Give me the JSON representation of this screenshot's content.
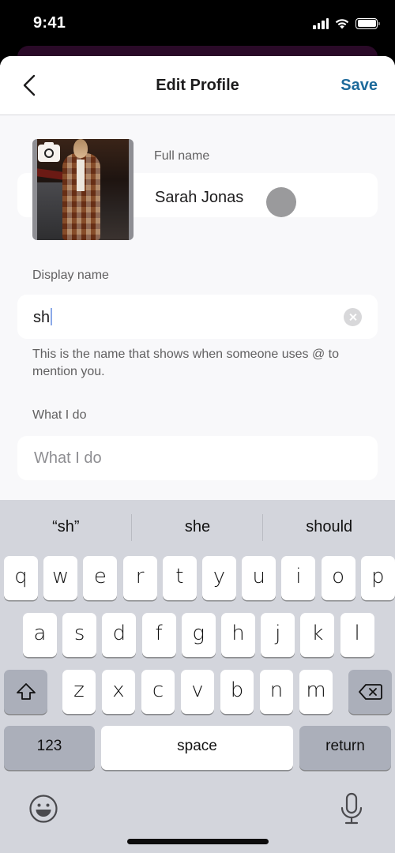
{
  "status_bar": {
    "time": "9:41",
    "signal_icon": "cellular-signal-icon",
    "wifi_icon": "wifi-icon",
    "battery_icon": "battery-icon",
    "battery_level_percent": 100
  },
  "nav": {
    "back_icon": "chevron-left-icon",
    "title": "Edit Profile",
    "save_label": "Save",
    "accent_color": "#1d6a9b"
  },
  "profile": {
    "photo_alt": "Profile photo",
    "camera_icon": "camera-icon",
    "full_name_label": "Full name",
    "full_name_value": "Sarah Jonas",
    "display_name_label": "Display name",
    "display_name_value": "sh",
    "clear_icon": "clear-circle-icon",
    "display_name_helper": "This is the name that shows when someone uses @ to mention you.",
    "what_i_do_label": "What I do",
    "what_i_do_value": "",
    "what_i_do_placeholder": "What I do"
  },
  "keyboard": {
    "suggestions": [
      "“sh”",
      "she",
      "should"
    ],
    "row1": [
      "q",
      "w",
      "e",
      "r",
      "t",
      "y",
      "u",
      "i",
      "o",
      "p"
    ],
    "row2": [
      "a",
      "s",
      "d",
      "f",
      "g",
      "h",
      "j",
      "k",
      "l"
    ],
    "row3": [
      "z",
      "x",
      "c",
      "v",
      "b",
      "n",
      "m"
    ],
    "shift_icon": "shift-icon",
    "delete_icon": "delete-backspace-icon",
    "numbers_label": "123",
    "space_label": "space",
    "return_label": "return",
    "emoji_icon": "emoji-icon",
    "mic_icon": "microphone-icon"
  }
}
